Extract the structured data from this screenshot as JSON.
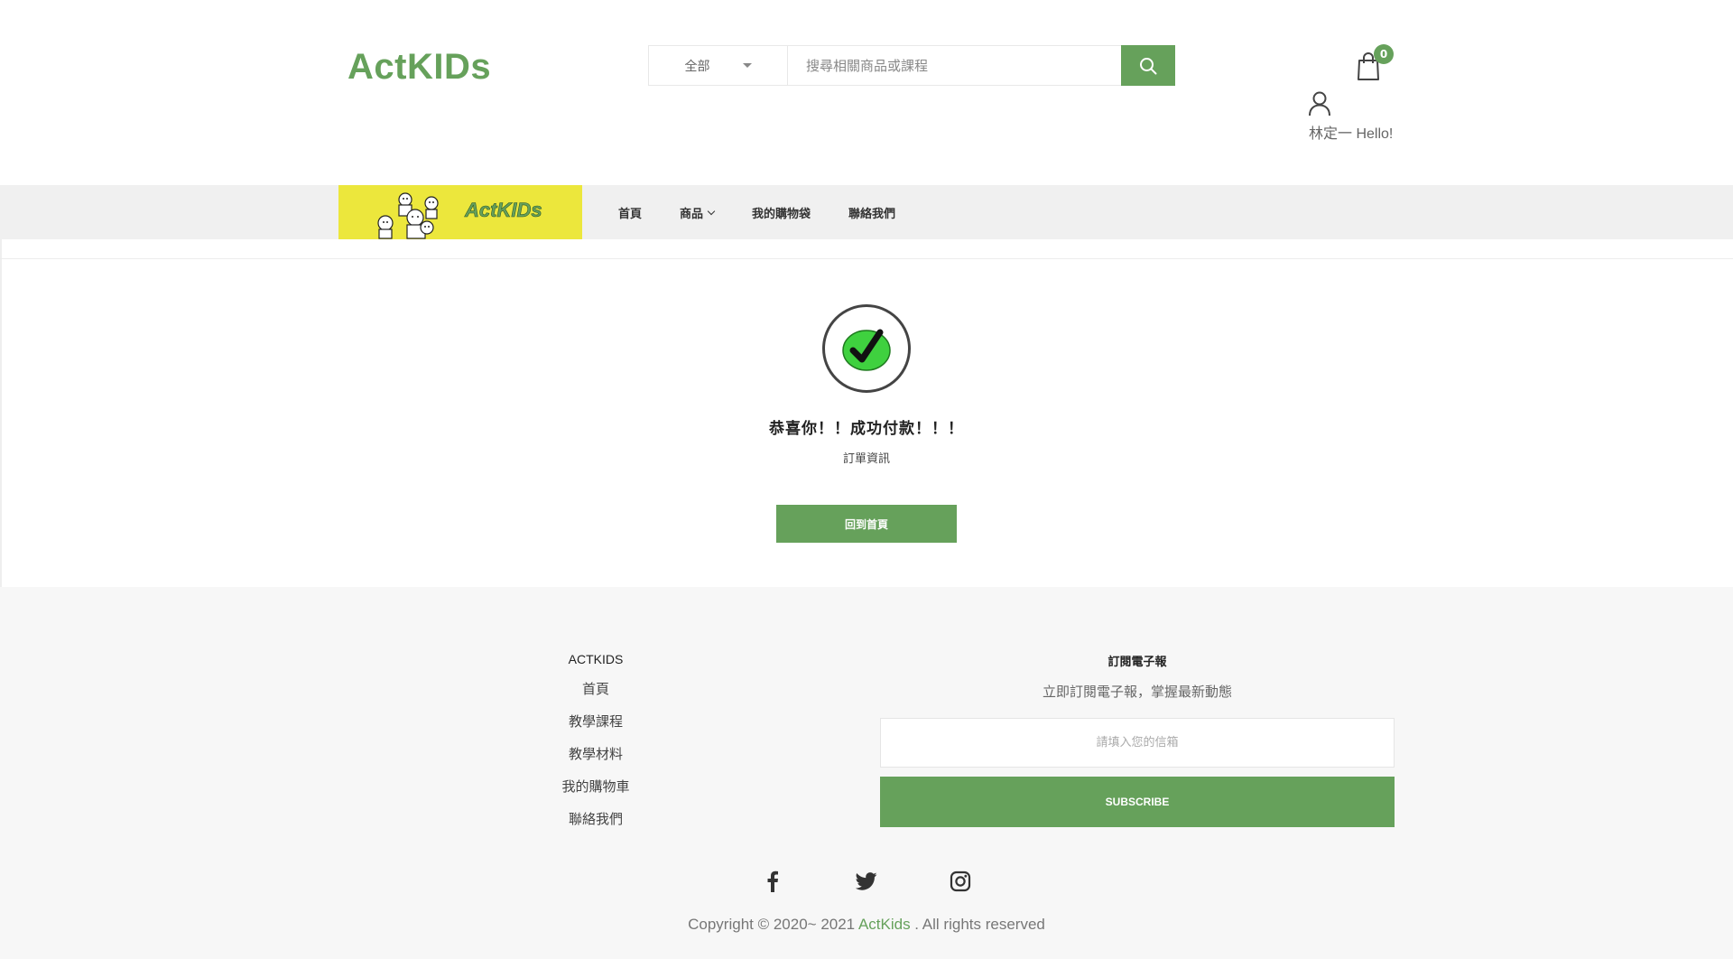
{
  "header": {
    "logo": "ActKIDs",
    "search": {
      "category": "全部",
      "placeholder": "搜尋相關商品或課程"
    },
    "cart_count": "0",
    "user_greeting": "林定一 Hello!"
  },
  "nav": {
    "logo_text": "ActKIDs",
    "items": [
      {
        "label": "首頁"
      },
      {
        "label": "商品"
      },
      {
        "label": "我的購物袋"
      },
      {
        "label": "聯絡我們"
      }
    ]
  },
  "main": {
    "title": "恭喜你！！成功付款！！！",
    "subtitle": "訂單資訊",
    "home_button": "回到首頁"
  },
  "footer": {
    "heading": "ACTKIDS",
    "links": [
      "首頁",
      "教學課程",
      "教學材料",
      "我的購物車",
      "聯絡我們"
    ],
    "newsletter": {
      "heading": "訂閱電子報",
      "subtitle": "立即訂閱電子報，掌握最新動態",
      "placeholder": "請填入您的信箱",
      "button": "SUBSCRIBE"
    },
    "social": [
      "facebook-icon",
      "twitter-icon",
      "instagram-icon"
    ],
    "copyright_pre": "Copyright © 2020~ 2021 ",
    "copyright_brand": "ActKids",
    "copyright_post": " . All rights reserved"
  },
  "colors": {
    "accent": "#66a15b",
    "nav_logo_bg": "#ece73c",
    "check_green": "#3fd13f"
  }
}
